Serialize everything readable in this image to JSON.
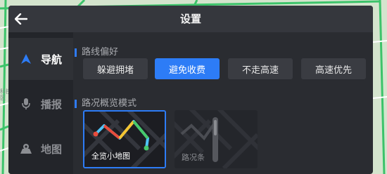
{
  "header": {
    "title": "设置",
    "back_icon": "arrow-left-icon"
  },
  "sidebar": {
    "items": [
      {
        "label": "导航",
        "icon": "navigation-arrow-icon",
        "active": true
      },
      {
        "label": "播报",
        "icon": "microphone-icon",
        "active": false
      },
      {
        "label": "地图",
        "icon": "map-pin-icon",
        "active": false
      }
    ]
  },
  "route_preference": {
    "title": "路线偏好",
    "options": [
      {
        "label": "躲避拥堵",
        "selected": false
      },
      {
        "label": "避免收费",
        "selected": true
      },
      {
        "label": "不走高速",
        "selected": false
      },
      {
        "label": "高速优先",
        "selected": false
      }
    ]
  },
  "overview_mode": {
    "title": "路况概览模式",
    "cards": [
      {
        "label": "全览小地图",
        "selected": true
      },
      {
        "label": "路况条",
        "selected": false
      }
    ]
  },
  "background": {
    "edge_text": "科技\n区"
  },
  "colors": {
    "accent": "#2d7cf6",
    "panel": "#2a2c31",
    "sidebar": "#23252a"
  }
}
